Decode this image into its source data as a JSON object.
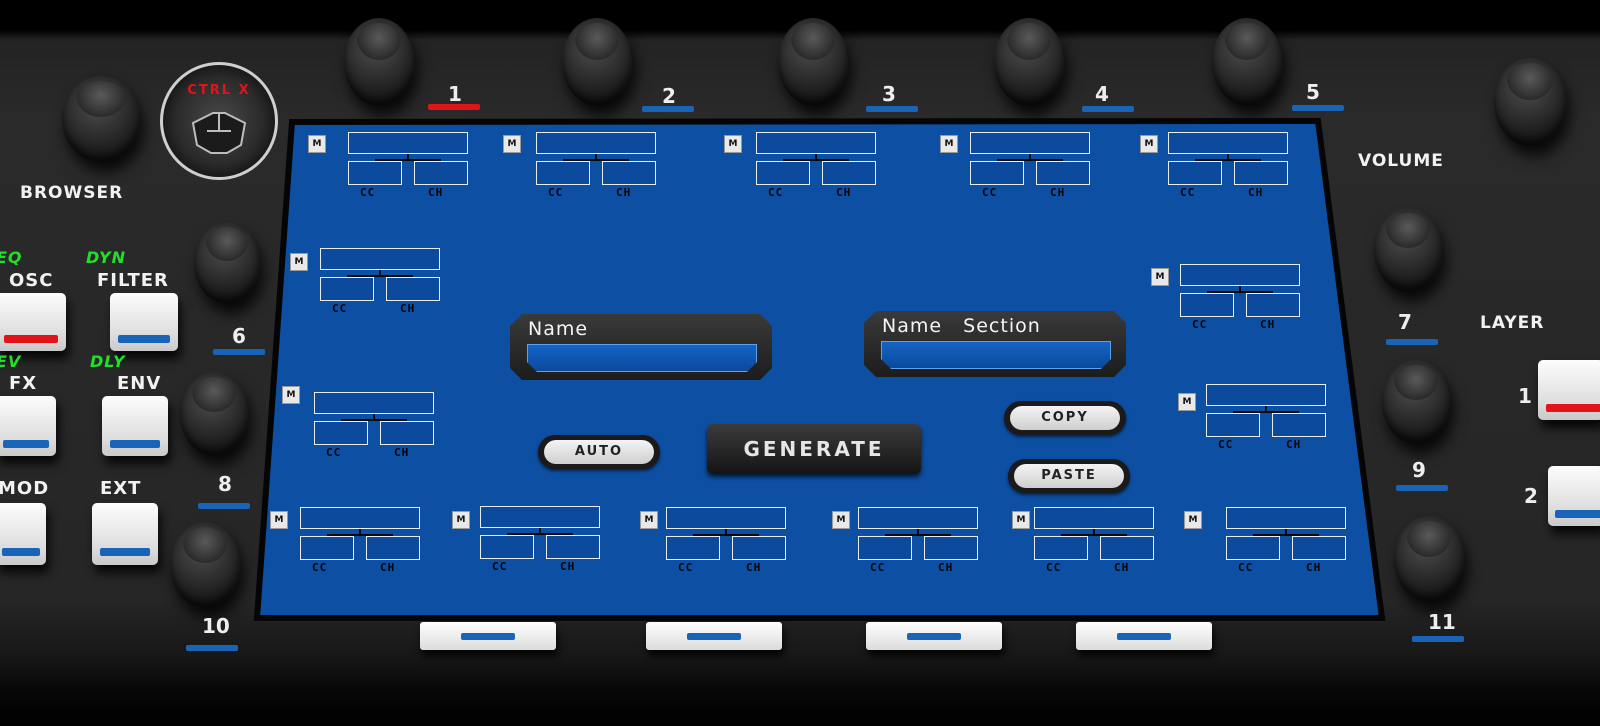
{
  "logo_text": "CTRL X",
  "hardware": {
    "browser_label": "BROWSER",
    "volume_label": "VOLUME",
    "layer_label": "LAYER",
    "left_buttons": [
      {
        "top": "EQ",
        "main": "OSC",
        "id": "osc"
      },
      {
        "top": "DYN",
        "main": "FILTER",
        "id": "filter"
      },
      {
        "top": "EV",
        "main": "FX",
        "id": "fx"
      },
      {
        "top": "DLY",
        "main": "ENV",
        "id": "env"
      },
      {
        "top": "",
        "main": "MOD",
        "id": "mod"
      },
      {
        "top": "",
        "main": "EXT",
        "id": "ext"
      }
    ],
    "knob_numbers": [
      "1",
      "2",
      "3",
      "4",
      "5",
      "6",
      "7",
      "8",
      "9",
      "10",
      "11"
    ],
    "layer_numbers": [
      "1",
      "2"
    ],
    "active_indicator_color": "#e2141a",
    "inactive_indicator_color": "#1a64b8"
  },
  "screen": {
    "m_button_label": "M",
    "cc_label": "CC",
    "ch_label": "CH",
    "name": {
      "label": "Name",
      "value": ""
    },
    "name_section": {
      "label": "Name   Section",
      "value": ""
    },
    "buttons": {
      "auto": "AUTO",
      "generate": "GENERATE",
      "copy": "COPY",
      "paste": "PASTE"
    },
    "background_color": "#0d4fa3"
  }
}
